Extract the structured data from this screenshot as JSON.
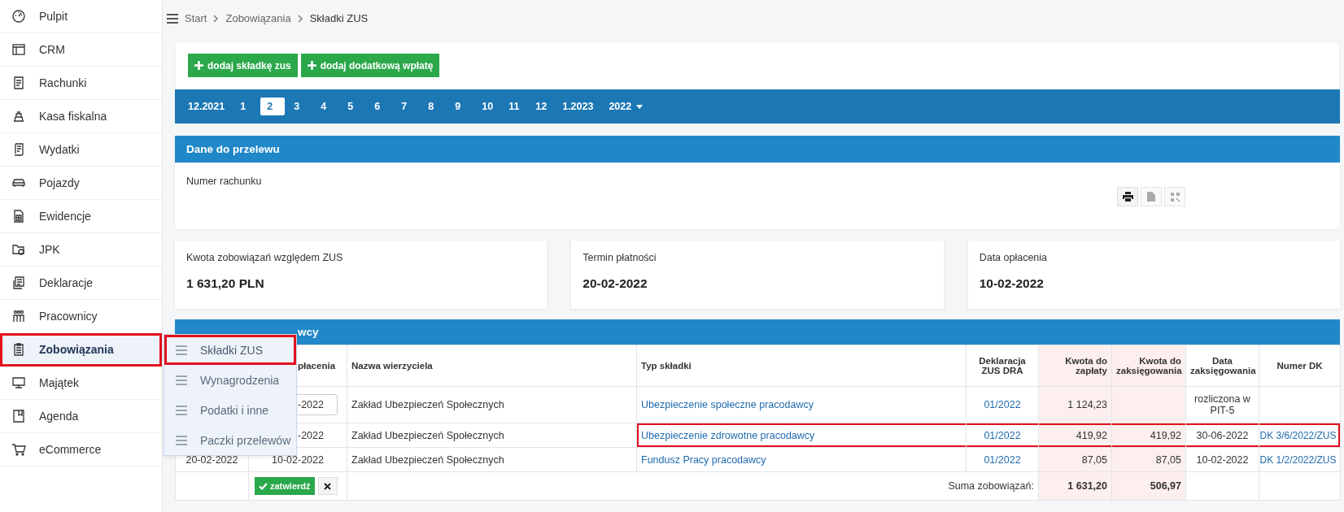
{
  "sidebar": {
    "items": [
      {
        "label": "Pulpit",
        "selected": false,
        "highlighted": false
      },
      {
        "label": "CRM",
        "selected": false,
        "highlighted": false
      },
      {
        "label": "Rachunki",
        "selected": false,
        "highlighted": false
      },
      {
        "label": "Kasa fiskalna",
        "selected": false,
        "highlighted": false
      },
      {
        "label": "Wydatki",
        "selected": false,
        "highlighted": false
      },
      {
        "label": "Pojazdy",
        "selected": false,
        "highlighted": false
      },
      {
        "label": "Ewidencje",
        "selected": false,
        "highlighted": false
      },
      {
        "label": "JPK",
        "selected": false,
        "highlighted": false
      },
      {
        "label": "Deklaracje",
        "selected": false,
        "highlighted": false
      },
      {
        "label": "Pracownicy",
        "selected": false,
        "highlighted": false
      },
      {
        "label": "Zobowiązania",
        "selected": true,
        "highlighted": true
      },
      {
        "label": "Majątek",
        "selected": false,
        "highlighted": false
      },
      {
        "label": "Agenda",
        "selected": false,
        "highlighted": false
      },
      {
        "label": "eCommerce",
        "selected": false,
        "highlighted": false
      }
    ]
  },
  "submenu": {
    "items": [
      {
        "label": "Składki ZUS",
        "selected": true,
        "highlighted": true
      },
      {
        "label": "Wynagrodzenia",
        "selected": false,
        "highlighted": false
      },
      {
        "label": "Podatki i inne",
        "selected": false,
        "highlighted": false
      },
      {
        "label": "Paczki przelewów",
        "selected": false,
        "highlighted": false
      }
    ]
  },
  "breadcrumb": [
    "Start",
    "Zobowiązania",
    "Składki ZUS"
  ],
  "toolbar": {
    "buttons": [
      "dodaj składkę zus",
      "dodaj dodatkową wpłatę"
    ]
  },
  "months": [
    {
      "label": "12.2021",
      "kind": "month",
      "selected": false
    },
    {
      "label": "1",
      "kind": "month",
      "selected": false
    },
    {
      "label": "2",
      "kind": "month",
      "selected": true
    },
    {
      "label": "3",
      "kind": "month",
      "selected": false
    },
    {
      "label": "4",
      "kind": "month",
      "selected": false
    },
    {
      "label": "5",
      "kind": "month",
      "selected": false
    },
    {
      "label": "6",
      "kind": "month",
      "selected": false
    },
    {
      "label": "7",
      "kind": "month",
      "selected": false
    },
    {
      "label": "8",
      "kind": "month",
      "selected": false
    },
    {
      "label": "9",
      "kind": "month",
      "selected": false
    },
    {
      "label": "10",
      "kind": "month",
      "selected": false
    },
    {
      "label": "11",
      "kind": "month",
      "selected": false
    },
    {
      "label": "12",
      "kind": "month",
      "selected": false
    },
    {
      "label": "1.2023",
      "kind": "month",
      "selected": false
    },
    {
      "label": "2022",
      "kind": "dropdown",
      "selected": false
    }
  ],
  "transfer_panel": {
    "title": "Dane do przelewu",
    "label": "Numer rachunku",
    "actions": [
      {
        "kind": "print",
        "disabled": false
      },
      {
        "kind": "document",
        "disabled": true
      },
      {
        "kind": "qr",
        "disabled": true
      }
    ]
  },
  "summary_cards": [
    {
      "label": "Kwota zobowiązań względem ZUS",
      "value": "1 631,20 PLN"
    },
    {
      "label": "Termin płatności",
      "value": "20-02-2022"
    },
    {
      "label": "Data opłacenia",
      "value": "10-02-2022"
    }
  ],
  "liabilities": {
    "title": "wcy",
    "columns": [
      "płacenia",
      "Nazwa wierzyciela",
      "Typ składki",
      "Deklaracja ZUS DRA",
      "Kwota do zapłaty",
      "Kwota do zaksięgowania",
      "Data zaksięgowania",
      "Numer DK"
    ],
    "rows": [
      {
        "payment_date": "-2022",
        "editable": true,
        "creditor": "Zakład Ubezpieczeń Społecznych",
        "type": "Ubezpieczenie społeczne pracodawcy",
        "declaration": "01/2022",
        "due": "1 124,23",
        "booking_date": "rozliczona w PIT-5",
        "highlighted": false
      },
      {
        "payment_date": "-2022",
        "editable": false,
        "creditor": "Zakład Ubezpieczeń Społecznych",
        "type": "Ubezpieczenie zdrowotne pracodawcy",
        "declaration": "01/2022",
        "due": "419,92",
        "booked": "419,92",
        "booking_date": "30-06-2022",
        "dk": "DK 3/6/2022/ZUS",
        "highlighted": true
      },
      {
        "due_date": "20-02-2022",
        "payment_date": "10-02-2022",
        "editable": false,
        "creditor": "Zakład Ubezpieczeń Społecznych",
        "type": "Fundusz Pracy pracodawcy",
        "declaration": "01/2022",
        "due": "87,05",
        "booked": "87,05",
        "booking_date": "10-02-2022",
        "dk": "DK 1/2/2022/ZUS",
        "highlighted": false
      }
    ],
    "footer": {
      "confirm": "zatwierdź",
      "label": "Suma zobowiązań:",
      "total_due": "1 631,20",
      "total_booked": "506,97"
    }
  }
}
